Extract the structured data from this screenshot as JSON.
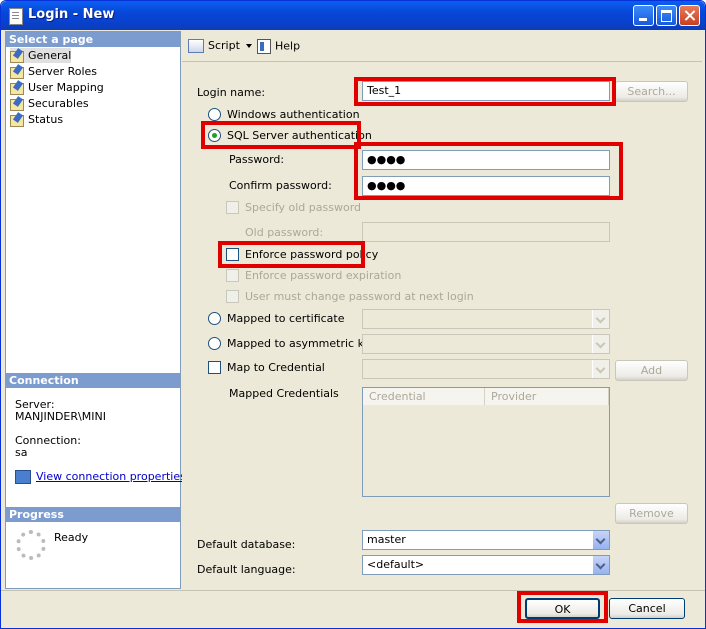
{
  "window": {
    "title": "Login - New"
  },
  "left": {
    "select_page_header": "Select a page",
    "pages": [
      "General",
      "Server Roles",
      "User Mapping",
      "Securables",
      "Status"
    ],
    "connection_header": "Connection",
    "server_label": "Server:",
    "server_value": "MANJINDER\\MINI",
    "connection_label": "Connection:",
    "connection_value": "sa",
    "view_connection_link": "View connection properties",
    "progress_header": "Progress",
    "progress_status": "Ready"
  },
  "toolbar": {
    "script": "Script",
    "help": "Help"
  },
  "form": {
    "login_name_label": "Login name:",
    "login_name_value": "Test_1",
    "search_button": "Search...",
    "windows_auth": "Windows authentication",
    "sql_auth": "SQL Server authentication",
    "password_label": "Password:",
    "password_value": "●●●●",
    "confirm_password_label": "Confirm password:",
    "confirm_password_value": "●●●●",
    "specify_old_password": "Specify old password",
    "old_password_label": "Old password:",
    "enforce_policy": "Enforce password policy",
    "enforce_expiration": "Enforce password expiration",
    "must_change": "User must change password at next login",
    "mapped_to_certificate": "Mapped to certificate",
    "mapped_to_asymmetric_key": "Mapped to asymmetric key",
    "map_to_credential": "Map to Credential",
    "add_button": "Add",
    "mapped_credentials_label": "Mapped Credentials",
    "grid_col_credential": "Credential",
    "grid_col_provider": "Provider",
    "remove_button": "Remove",
    "default_database_label": "Default database:",
    "default_database_value": "master",
    "default_language_label": "Default language:",
    "default_language_value": "<default>"
  },
  "buttons": {
    "ok": "OK",
    "cancel": "Cancel"
  },
  "colors": {
    "highlight": "#E00000",
    "title_bar": "#0A5FF0",
    "section_header": "#7C9CD0"
  }
}
